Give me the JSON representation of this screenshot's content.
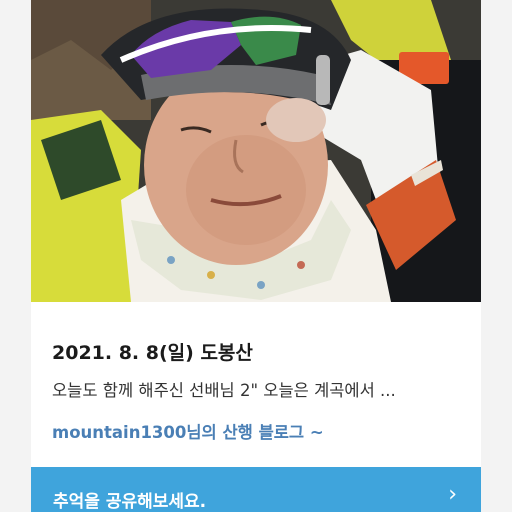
{
  "post": {
    "date_title": "2021. 8. 8(일) 도봉산",
    "excerpt": "오늘도 함께 해주신 선배님 2\" 오늘은 계곡에서 ...",
    "author_line": "mountain1300님의 산행 블로그 ~"
  },
  "share": {
    "label": "추억을 공유해보세요.",
    "chevron": "›"
  },
  "photo": {
    "alt": ""
  },
  "colors": {
    "share_bar": "#3fa4dc",
    "author_link": "#4a7fb5",
    "title_text": "#1b1b1b"
  }
}
